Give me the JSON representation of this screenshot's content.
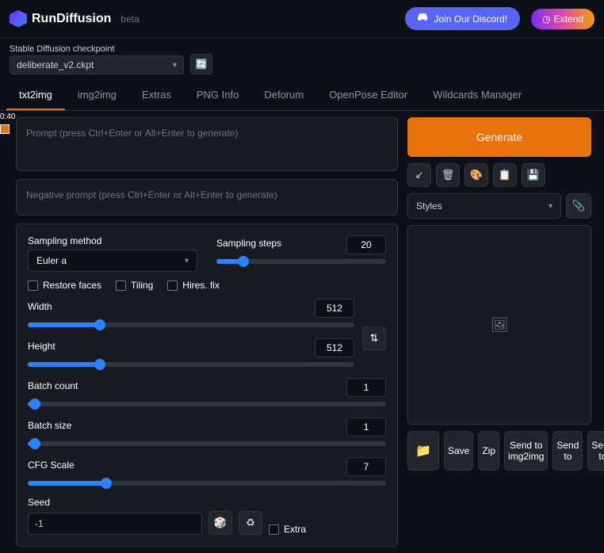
{
  "header": {
    "brand": "RunDiffusion",
    "beta": "beta",
    "discord": "Join Our Discord!",
    "extend": "Extend"
  },
  "checkpoint": {
    "label": "Stable Diffusion checkpoint",
    "value": "deliberate_v2.ckpt"
  },
  "tabs": [
    "txt2img",
    "img2img",
    "Extras",
    "PNG Info",
    "Deforum",
    "OpenPose Editor",
    "Wildcards Manager"
  ],
  "active_tab": "txt2img",
  "timer": "0:40",
  "prompt": {
    "placeholder": "Prompt (press Ctrl+Enter or Alt+Enter to generate)",
    "neg_placeholder": "Negative prompt (press Ctrl+Enter or Alt+Enter to generate)"
  },
  "generate": "Generate",
  "styles_label": "Styles",
  "sampling": {
    "method_label": "Sampling method",
    "method_value": "Euler a",
    "steps_label": "Sampling steps",
    "steps_value": "20"
  },
  "checks": {
    "restore": "Restore faces",
    "tiling": "Tiling",
    "hires": "Hires. fix"
  },
  "width_label": "Width",
  "width_value": "512",
  "height_label": "Height",
  "height_value": "512",
  "batch_count_label": "Batch count",
  "batch_count_value": "1",
  "batch_size_label": "Batch size",
  "batch_size_value": "1",
  "cfg_label": "CFG Scale",
  "cfg_value": "7",
  "seed_label": "Seed",
  "seed_value": "-1",
  "extra_label": "Extra",
  "actions": {
    "save": "Save",
    "zip": "Zip",
    "send_img2img": "Send to img2img",
    "send_label": "Send to"
  }
}
